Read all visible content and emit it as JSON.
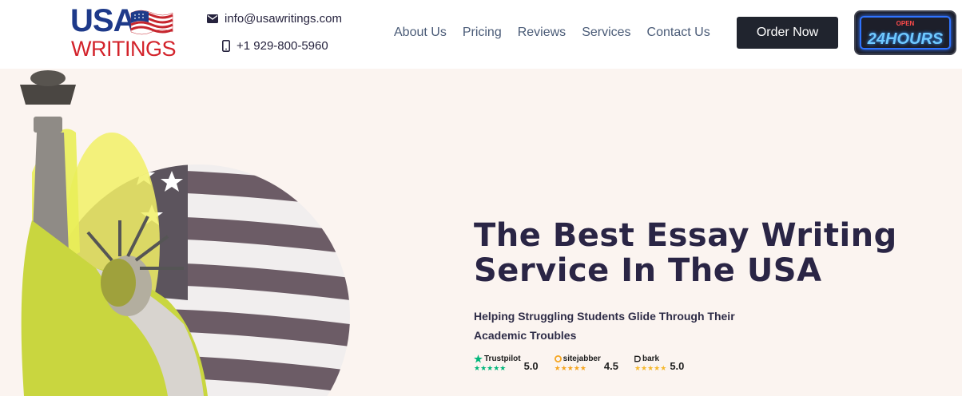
{
  "header": {
    "logo": {
      "line1": "USA",
      "line2": "WRITINGS"
    },
    "email": "info@usawritings.com",
    "phone": "+1 929-800-5960",
    "nav": [
      "About Us",
      "Pricing",
      "Reviews",
      "Services",
      "Contact Us"
    ],
    "order_button": "Order Now",
    "open_sign": {
      "top": "OPEN",
      "main": "24HOURS"
    }
  },
  "hero": {
    "headline": "The Best Essay Writing Service In The USA",
    "subline": "Helping Struggling Students Glide Through Their Academic Troubles",
    "ratings": [
      {
        "brand": "Trustpilot",
        "score": "5.0",
        "star_color": "#00b67a"
      },
      {
        "brand": "sitejabber",
        "score": "4.5",
        "star_color": "#f5a623"
      },
      {
        "brand": "bark",
        "score": "5.0",
        "star_color": "#f5b82e"
      }
    ]
  },
  "colors": {
    "background": "#fbf4f0",
    "header": "#ffffff",
    "headline": "#2a2545",
    "nav": "#4a5b77",
    "button": "#20242e",
    "logo_blue": "#1e3a8a",
    "logo_red": "#d3232b"
  }
}
